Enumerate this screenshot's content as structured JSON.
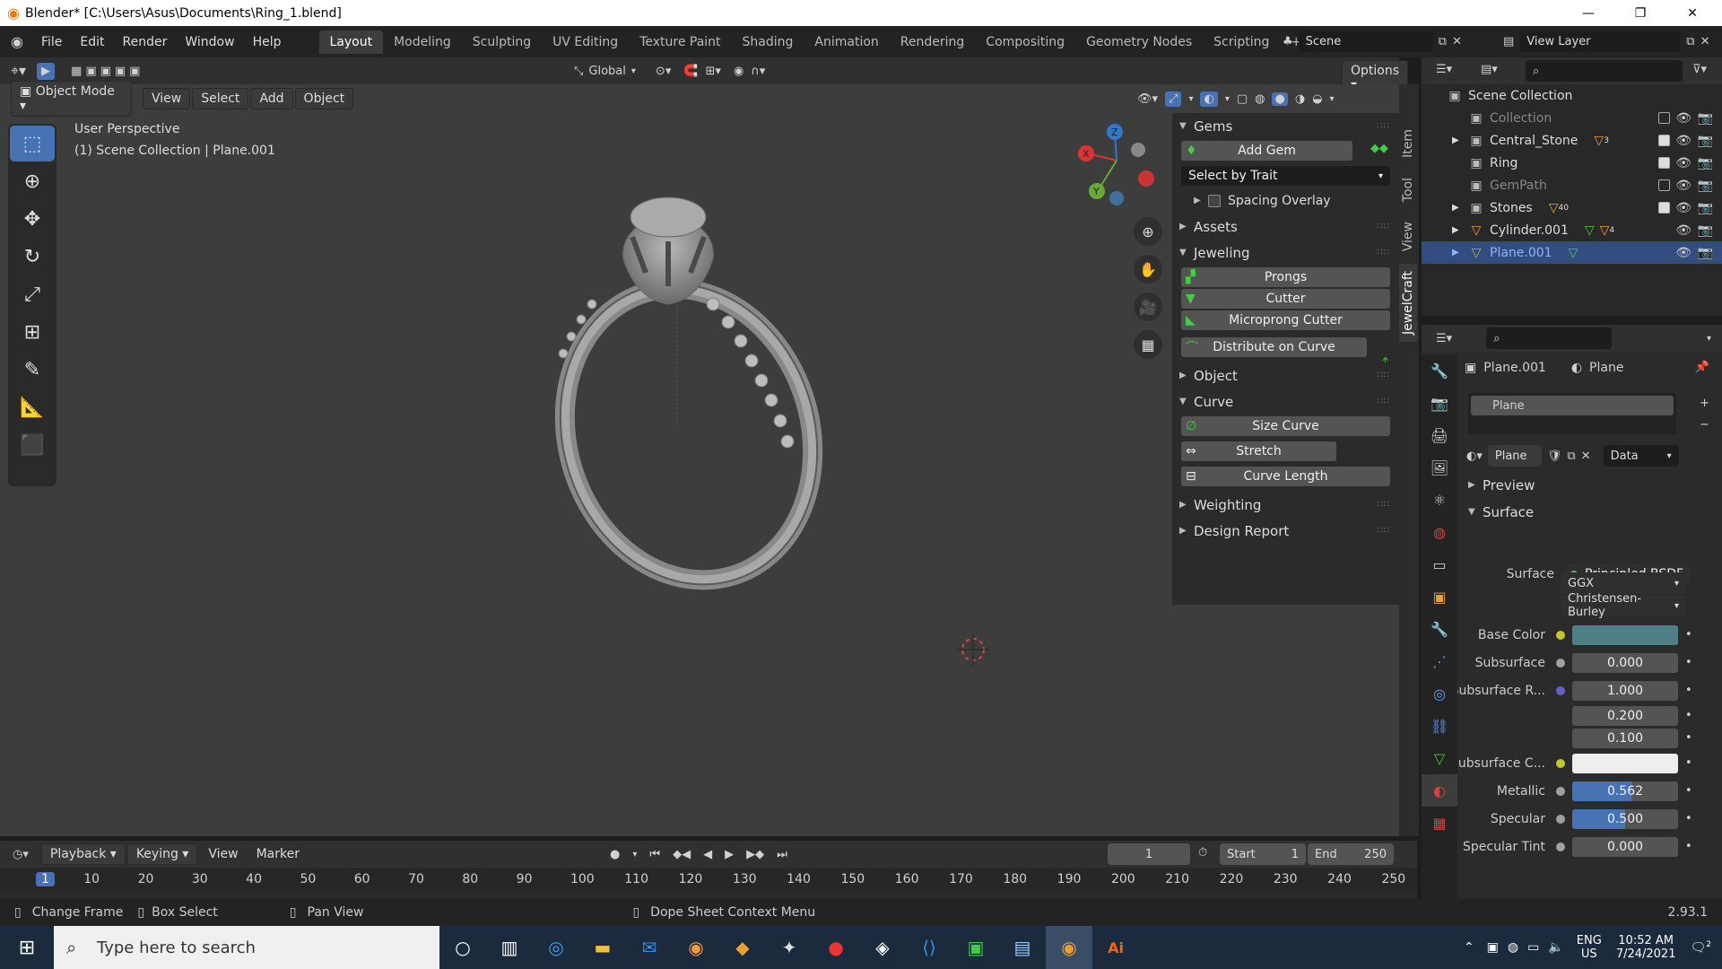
{
  "window": {
    "title": "Blender* [C:\\Users\\Asus\\Documents\\Ring_1.blend]",
    "min": "—",
    "max": "❐",
    "close": "✕"
  },
  "menus": [
    "File",
    "Edit",
    "Render",
    "Window",
    "Help"
  ],
  "workspaces": [
    {
      "label": "Layout",
      "active": true
    },
    {
      "label": "Modeling"
    },
    {
      "label": "Sculpting"
    },
    {
      "label": "UV Editing"
    },
    {
      "label": "Texture Paint"
    },
    {
      "label": "Shading"
    },
    {
      "label": "Animation"
    },
    {
      "label": "Rendering"
    },
    {
      "label": "Compositing"
    },
    {
      "label": "Geometry Nodes"
    },
    {
      "label": "Scripting"
    }
  ],
  "add_workspace": "+",
  "scene": "Scene",
  "view_layer": "View Layer",
  "toolbar": {
    "orientation": "Global",
    "options": "Options"
  },
  "viewport": {
    "mode": "Object Mode",
    "menus": [
      "View",
      "Select",
      "Add",
      "Object"
    ],
    "info_line1": "User Perspective",
    "info_line2": "(1) Scene Collection | Plane.001"
  },
  "npanel_tabs": [
    "Item",
    "Tool",
    "View",
    "JewelCraft"
  ],
  "npanel": {
    "gems_header": "Gems",
    "add_gem": "Add Gem",
    "select_by_trait": "Select by Trait",
    "spacing_overlay": "Spacing Overlay",
    "assets": "Assets",
    "jeweling": "Jeweling",
    "prongs": "Prongs",
    "cutter": "Cutter",
    "microprong": "Microprong Cutter",
    "distribute": "Distribute on Curve",
    "object": "Object",
    "curve": "Curve",
    "size_curve": "Size Curve",
    "stretch": "Stretch",
    "curve_length": "Curve Length",
    "weighting": "Weighting",
    "design_report": "Design Report"
  },
  "outliner": {
    "root": "Scene Collection",
    "rows": [
      {
        "name": "Collection",
        "dim": true,
        "badge": ""
      },
      {
        "name": "Central_Stone",
        "badge": "3"
      },
      {
        "name": "Ring",
        "badge": ""
      },
      {
        "name": "GemPath",
        "dim": true,
        "badge": ""
      },
      {
        "name": "Stones",
        "badge": "40"
      },
      {
        "name": "Cylinder.001",
        "badge": "4"
      },
      {
        "name": "Plane.001",
        "selected": true,
        "badge": ""
      }
    ]
  },
  "properties": {
    "object": "Plane.001",
    "material": "Plane",
    "slot": "Plane",
    "mat_name": "Plane",
    "data": "Data",
    "preview": "Preview",
    "surface_header": "Surface",
    "surface_label": "Surface",
    "surface_value": "Principled BSDF",
    "distribution": "GGX",
    "subsurface_method": "Christensen-Burley",
    "rows": [
      {
        "label": "Base Color",
        "value": "",
        "dot": "#c7c729",
        "swatch": "#4f7f87"
      },
      {
        "label": "Subsurface",
        "value": "0.000",
        "dot": "#a0a0a0"
      },
      {
        "label": "Subsurface R...",
        "value": "1.000",
        "dot": "#6363c7"
      },
      {
        "label": "",
        "value": "0.200"
      },
      {
        "label": "",
        "value": "0.100"
      },
      {
        "label": "Subsurface C...",
        "value": "",
        "dot": "#c7c729",
        "swatch": "#eeeeee"
      },
      {
        "label": "Metallic",
        "value": "0.562",
        "dot": "#a0a0a0",
        "fill": 0.562
      },
      {
        "label": "Specular",
        "value": "0.500",
        "dot": "#a0a0a0",
        "fill": 0.5
      },
      {
        "label": "Specular Tint",
        "value": "0.000",
        "dot": "#a0a0a0"
      }
    ]
  },
  "timeline": {
    "menus": [
      "Playback",
      "Keying",
      "View",
      "Marker"
    ],
    "current": "1",
    "start_label": "Start",
    "start": "1",
    "end_label": "End",
    "end": "250",
    "ticks": [
      "1",
      "10",
      "20",
      "30",
      "40",
      "50",
      "60",
      "70",
      "80",
      "90",
      "100",
      "110",
      "120",
      "130",
      "140",
      "150",
      "160",
      "170",
      "180",
      "190",
      "200",
      "210",
      "220",
      "230",
      "240",
      "250"
    ]
  },
  "status": {
    "change_frame": "Change Frame",
    "box_select": "Box Select",
    "pan_view": "Pan View",
    "context": "Dope Sheet Context Menu",
    "version": "2.93.1"
  },
  "taskbar": {
    "search": "Type here to search",
    "lang1": "ENG",
    "lang2": "US",
    "time": "10:52 AM",
    "date": "7/24/2021",
    "notif": "2"
  },
  "colors": {
    "accent": "#4772b3",
    "selected": "#334d80",
    "viewport": "#3d3d3d"
  }
}
